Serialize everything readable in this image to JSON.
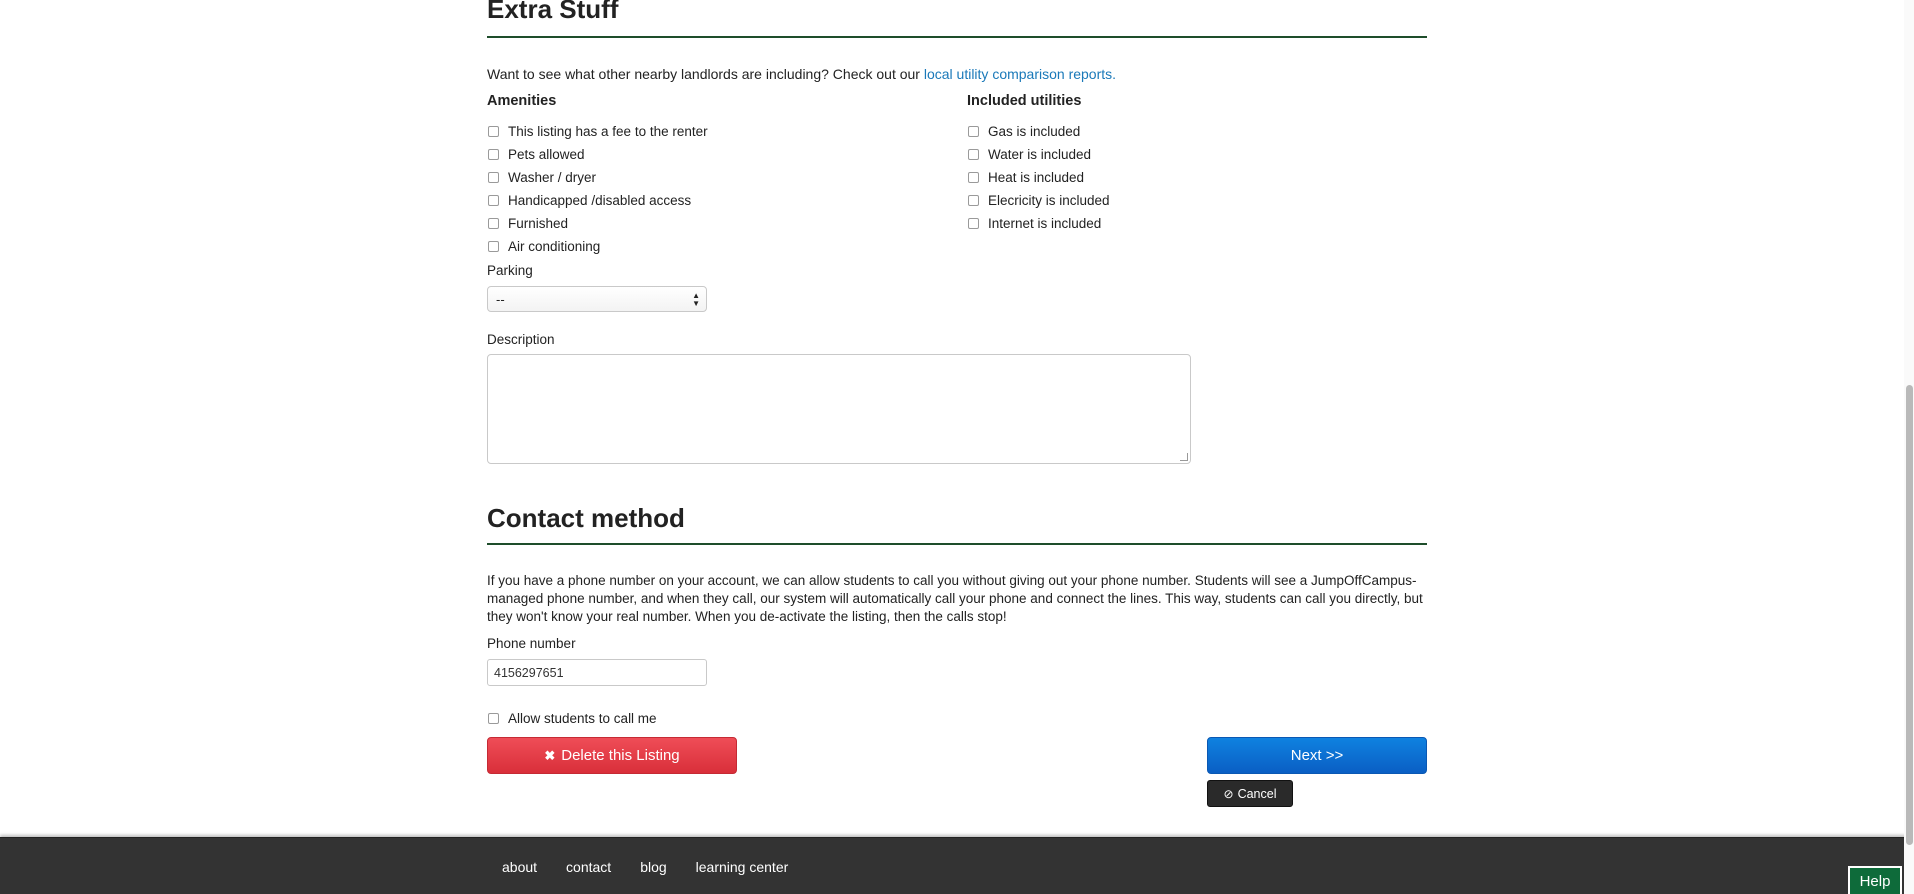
{
  "extra": {
    "title": "Extra Stuff",
    "intro_text": "Want to see what other nearby landlords are including? Check out our ",
    "intro_link": "local utility comparison reports."
  },
  "amenities": {
    "heading": "Amenities",
    "items": [
      {
        "label": "This listing has a fee to the renter",
        "checked": false
      },
      {
        "label": "Pets allowed",
        "checked": false
      },
      {
        "label": "Washer / dryer",
        "checked": false
      },
      {
        "label": "Handicapped /disabled access",
        "checked": false
      },
      {
        "label": "Furnished",
        "checked": false
      },
      {
        "label": "Air conditioning",
        "checked": false
      }
    ]
  },
  "utilities": {
    "heading": "Included utilities",
    "items": [
      {
        "label": "Gas is included",
        "checked": false
      },
      {
        "label": "Water is included",
        "checked": false
      },
      {
        "label": "Heat is included",
        "checked": false
      },
      {
        "label": "Elecricity is included",
        "checked": false
      },
      {
        "label": "Internet is included",
        "checked": false
      }
    ]
  },
  "parking": {
    "label": "Parking",
    "selected": "--"
  },
  "description": {
    "label": "Description",
    "value": ""
  },
  "contact": {
    "title": "Contact method",
    "text": "If you have a phone number on your account, we can allow students to call you without giving out your phone number. Students will see a JumpOffCampus-managed phone number, and when they call, our system will automatically call your phone and connect the lines. This way, students can call you directly, but they won't know your real number. When you de-activate the listing, then the calls stop!",
    "phone_label": "Phone number",
    "phone_value": "4156297651",
    "allow_label": "Allow students to call me",
    "allow_checked": false
  },
  "buttons": {
    "delete": "Delete this Listing",
    "next": "Next >>",
    "cancel": "Cancel"
  },
  "footer": {
    "links": [
      "about",
      "contact",
      "blog",
      "learning center"
    ],
    "help": "Help"
  },
  "colors": {
    "rule_green": "#1e4d2b",
    "link_blue": "#1a79b9",
    "delete_red": "#e03d47",
    "next_blue": "#0a6fd4",
    "footer_bg": "#333333",
    "help_green": "#0e6b3a"
  }
}
